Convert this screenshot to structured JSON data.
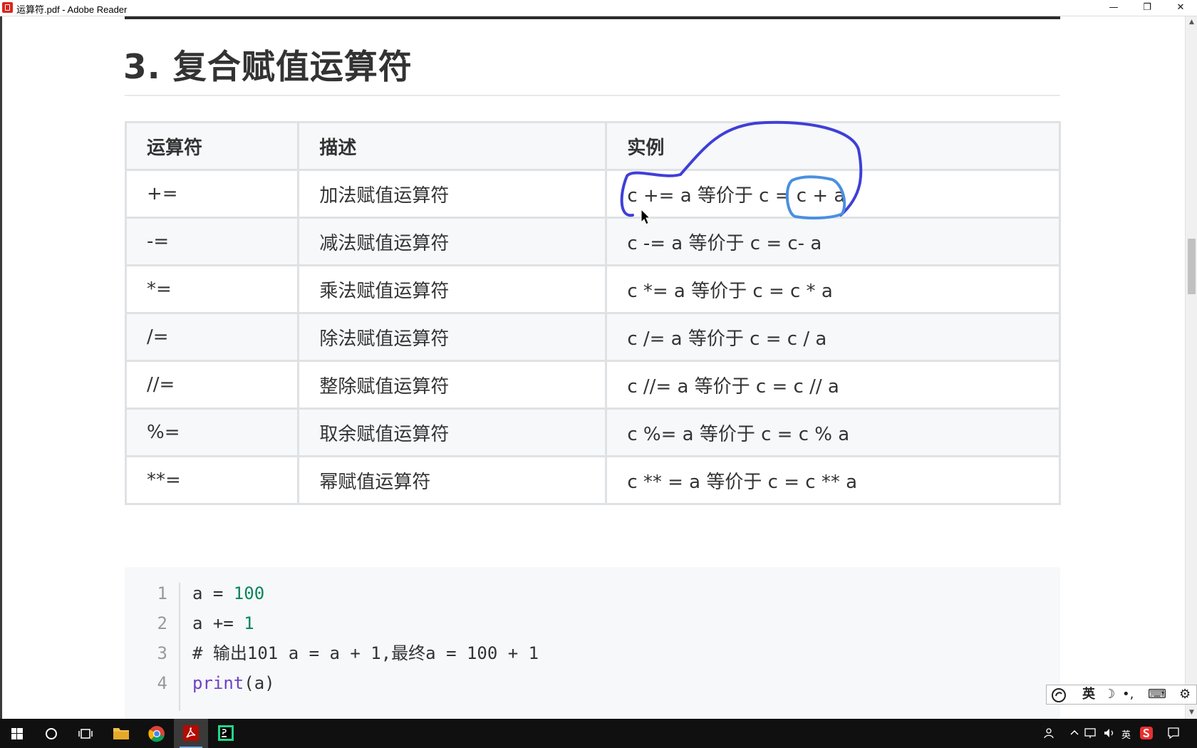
{
  "window": {
    "title": "运算符.pdf - Adobe Reader",
    "min_glyph": "—",
    "max_glyph": "❐",
    "close_glyph": "✕"
  },
  "document": {
    "heading": "3. 复合赋值运算符",
    "table": {
      "headers": [
        "运算符",
        "描述",
        "实例"
      ],
      "rows": [
        [
          "+=",
          "加法赋值运算符",
          "c += a 等价于 c = c + a"
        ],
        [
          "-=",
          "减法赋值运算符",
          "c -= a 等价于 c = c- a"
        ],
        [
          "*=",
          "乘法赋值运算符",
          "c *= a 等价于 c = c * a"
        ],
        [
          "/=",
          "除法赋值运算符",
          "c /= a 等价于 c = c / a"
        ],
        [
          "//=",
          "整除赋值运算符",
          "c //= a 等价于 c = c // a"
        ],
        [
          "%=",
          "取余赋值运算符",
          "c %= a 等价于 c = c % a"
        ],
        [
          "**=",
          "幂赋值运算符",
          "c ** = a 等价于 c = c ** a"
        ]
      ]
    },
    "code": {
      "lines": [
        {
          "num": "1",
          "parts": [
            "a = ",
            "100"
          ]
        },
        {
          "num": "2",
          "parts": [
            "a += ",
            "1"
          ]
        },
        {
          "num": "3",
          "comment": "# 输出101  a = a + 1,最终a = 100 + 1"
        },
        {
          "num": "4",
          "fn": "print",
          "rest": "(a)"
        }
      ]
    }
  },
  "annotations": {
    "pen_color_dark": "#3f3fd8",
    "pen_color_light": "#4a8fe0"
  },
  "ime_toolbar": {
    "lang": "英",
    "moon": "☽",
    "punct": "•,",
    "keyboard": "⌨",
    "settings": "⚙"
  },
  "taskbar": {
    "tray_lang": "英",
    "tray_icons": [
      "person-icon",
      "chevron-up-icon",
      "network-icon",
      "volume-icon"
    ]
  }
}
